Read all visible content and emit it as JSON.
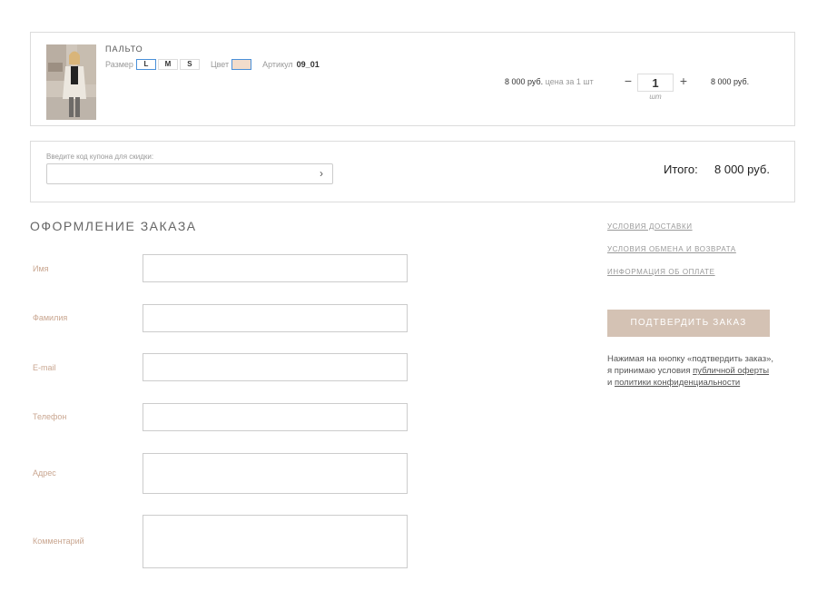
{
  "cart": {
    "item": {
      "name": "ПАЛЬТО",
      "size_label": "Размер",
      "sizes": [
        "L",
        "M",
        "S"
      ],
      "selected_size": "L",
      "color_label": "Цвет",
      "color_value": "#f2dccb",
      "sku_label": "Артикул",
      "sku": "09_01",
      "price": "8 000 руб.",
      "price_note": "цена за 1 шт",
      "qty_minus": "−",
      "qty_plus": "+",
      "quantity": "1",
      "qty_unit": "шт",
      "line_total": "8 000 руб."
    }
  },
  "coupon": {
    "label": "Введите код купона для скидки:",
    "value": "",
    "submit_icon": "chevron-right-icon",
    "submit_glyph": "›"
  },
  "summary": {
    "total_label": "Итого:",
    "total_value": "8 000 руб."
  },
  "checkout": {
    "title": "ОФОРМЛЕНИЕ ЗАКАЗА",
    "fields": {
      "name": "Имя",
      "surname": "Фамилия",
      "email": "E-mail",
      "phone": "Телефон",
      "address": "Адрес",
      "comment": "Комментарий"
    }
  },
  "sidebar": {
    "links": {
      "delivery": "УСЛОВИЯ ДОСТАВКИ",
      "exchange": "УСЛОВИЯ ОБМЕНА И ВОЗВРАТА",
      "payment": "ИНФОРМАЦИЯ ОБ ОПЛАТЕ"
    },
    "confirm_button": "ПОДТВЕРДИТЬ ЗАКАЗ",
    "consent": {
      "line1": "Нажимая на кнопку «подтвердить заказ»,",
      "line2_prefix": "я принимаю условия ",
      "offer_link": "публичной оферты",
      "line3_prefix": "и ",
      "privacy_link": "политики конфиденциальности"
    }
  },
  "colors": {
    "accent_button": "#d4c2b4",
    "label_color": "#c9a690",
    "selected_outline": "#4a90d9"
  }
}
